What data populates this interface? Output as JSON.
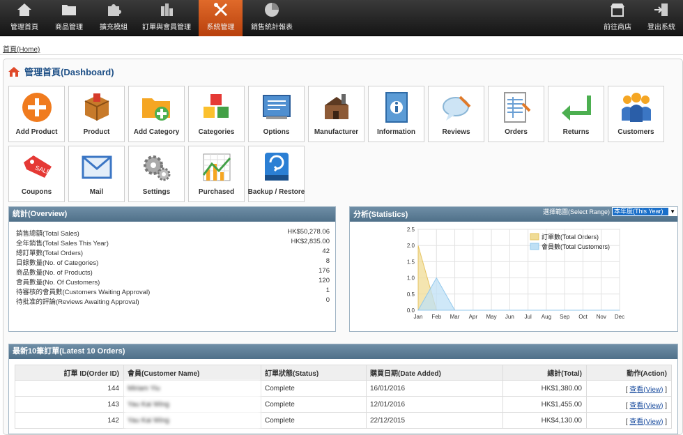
{
  "nav": {
    "items": [
      {
        "label": "管理首頁",
        "icon": "home-icon"
      },
      {
        "label": "商品管理",
        "icon": "folder-icon"
      },
      {
        "label": "擴充模組",
        "icon": "puzzle-icon"
      },
      {
        "label": "訂單與會員管理",
        "icon": "coins-icon"
      },
      {
        "label": "系統管理",
        "icon": "tools-icon"
      },
      {
        "label": "銷售統計報表",
        "icon": "pie-chart-icon"
      }
    ],
    "right": [
      {
        "label": "前往商店",
        "icon": "store-icon"
      },
      {
        "label": "登出系統",
        "icon": "logout-icon"
      }
    ],
    "active_index": 4
  },
  "breadcrumb": "首頁(Home)",
  "page_title": "管理首頁(Dashboard)",
  "tiles": [
    {
      "label": "Add Product",
      "icon": "add-product-icon"
    },
    {
      "label": "Product",
      "icon": "product-box-icon"
    },
    {
      "label": "Add Category",
      "icon": "add-category-folder-icon"
    },
    {
      "label": "Categories",
      "icon": "categories-cubes-icon"
    },
    {
      "label": "Options",
      "icon": "options-icon"
    },
    {
      "label": "Manufacturer",
      "icon": "factory-icon"
    },
    {
      "label": "Information",
      "icon": "information-book-icon"
    },
    {
      "label": "Reviews",
      "icon": "review-bubble-icon"
    },
    {
      "label": "Orders",
      "icon": "orders-sheet-icon"
    },
    {
      "label": "Returns",
      "icon": "return-arrow-icon"
    },
    {
      "label": "Customers",
      "icon": "customers-people-icon"
    },
    {
      "label": "Coupons",
      "icon": "sale-tag-icon"
    },
    {
      "label": "Mail",
      "icon": "envelope-icon"
    },
    {
      "label": "Settings",
      "icon": "gears-icon"
    },
    {
      "label": "Purchased",
      "icon": "purchased-chart-icon"
    },
    {
      "label": "Backup / Restore",
      "icon": "backup-drive-icon"
    }
  ],
  "overview": {
    "title": "統計(Overview)",
    "rows": [
      {
        "label": "銷售總額(Total Sales)",
        "value": "HK$50,278.06"
      },
      {
        "label": "全年銷售(Total Sales This Year)",
        "value": "HK$2,835.00"
      },
      {
        "label": "總訂單數(Total Orders)",
        "value": "42"
      },
      {
        "label": "目錄數量(No. of Categories)",
        "value": "8"
      },
      {
        "label": "商品數量(No. of Products)",
        "value": "176"
      },
      {
        "label": "會員數量(No. Of Customers)",
        "value": "120"
      },
      {
        "label": "待審核的會員數(Customers Waiting Approval)",
        "value": "1"
      },
      {
        "label": "待批准的評論(Reviews Awaiting Approval)",
        "value": "0"
      }
    ]
  },
  "statistics": {
    "title": "分析(Statistics)",
    "range_label": "選擇範圍(Select Range)",
    "range_value": "本年度(This Year)",
    "colors": {
      "orders": "#f0dc96",
      "customers": "#bfe0f5"
    }
  },
  "chart_data": {
    "type": "area",
    "categories": [
      "Jan",
      "Feb",
      "Mar",
      "Apr",
      "May",
      "Jun",
      "Jul",
      "Aug",
      "Sep",
      "Oct",
      "Nov",
      "Dec"
    ],
    "yticks": [
      "0.0",
      "0.5",
      "1.0",
      "1.5",
      "2.0",
      "2.5"
    ],
    "ylim": [
      0,
      2.5
    ],
    "series": [
      {
        "name": "訂單數(Total Orders)",
        "values": [
          2,
          0,
          0,
          0,
          0,
          0,
          0,
          0,
          0,
          0,
          0,
          0
        ]
      },
      {
        "name": "會員數(Total Customers)",
        "values": [
          0,
          1,
          0,
          0,
          0,
          0,
          0,
          0,
          0,
          0,
          0,
          0
        ]
      }
    ],
    "legend": "top-right",
    "grid": true
  },
  "latest": {
    "title": "最新10筆訂單(Latest 10 Orders)",
    "headers": [
      "訂單 ID(Order ID)",
      "會員(Customer Name)",
      "訂單狀態(Status)",
      "購買日期(Date Added)",
      "總計(Total)",
      "動作(Action)"
    ],
    "rows": [
      {
        "id": "144",
        "customer": "Miriam Yiu",
        "status": "Complete",
        "date": "16/01/2016",
        "total": "HK$1,380.00",
        "action": "查看(View)"
      },
      {
        "id": "143",
        "customer": "Yau Kai Wing",
        "status": "Complete",
        "date": "12/01/2016",
        "total": "HK$1,455.00",
        "action": "查看(View)"
      },
      {
        "id": "142",
        "customer": "Yau Kai Wing",
        "status": "Complete",
        "date": "22/12/2015",
        "total": "HK$4,130.00",
        "action": "查看(View)"
      }
    ]
  }
}
